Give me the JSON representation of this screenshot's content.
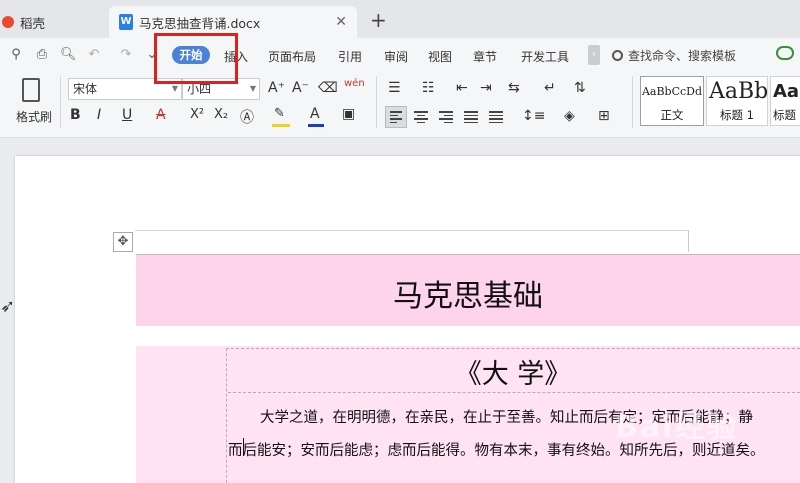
{
  "tabs": {
    "inactive": "稻壳",
    "active": "马克思抽查背诵.docx",
    "doc_icon": "W"
  },
  "menu": {
    "start": "开始",
    "insert": "插入",
    "page_layout": "页面布局",
    "reference": "引用",
    "review": "审阅",
    "view": "视图",
    "chapter": "章节",
    "developer": "开发工具",
    "search_placeholder": "查找命令、搜索模板"
  },
  "toolbar": {
    "format_painter": "格式刷",
    "font_name": "宋体",
    "font_size": "小四",
    "bold": "B",
    "italic": "I",
    "underline": "U",
    "strike": "A",
    "superscript": "X²",
    "subscript": "X₂",
    "wen": "wén"
  },
  "styles": [
    {
      "sample": "AaBbCcDd",
      "label": "正文"
    },
    {
      "sample": "AaBb",
      "label": "标题 1"
    },
    {
      "sample": "Aa",
      "label": "标题"
    }
  ],
  "document": {
    "title": "马克思基础",
    "subtitle": "《大 学》",
    "line1": "大学之道，在明明德，在亲民，在止于至善。知止而后有定；定而后能静；静",
    "line2": "而后能安；安而后能虑；虑而后能得。物有本末，事有终始。知所先后，则近道矣。"
  },
  "watermark": "Bai经验"
}
